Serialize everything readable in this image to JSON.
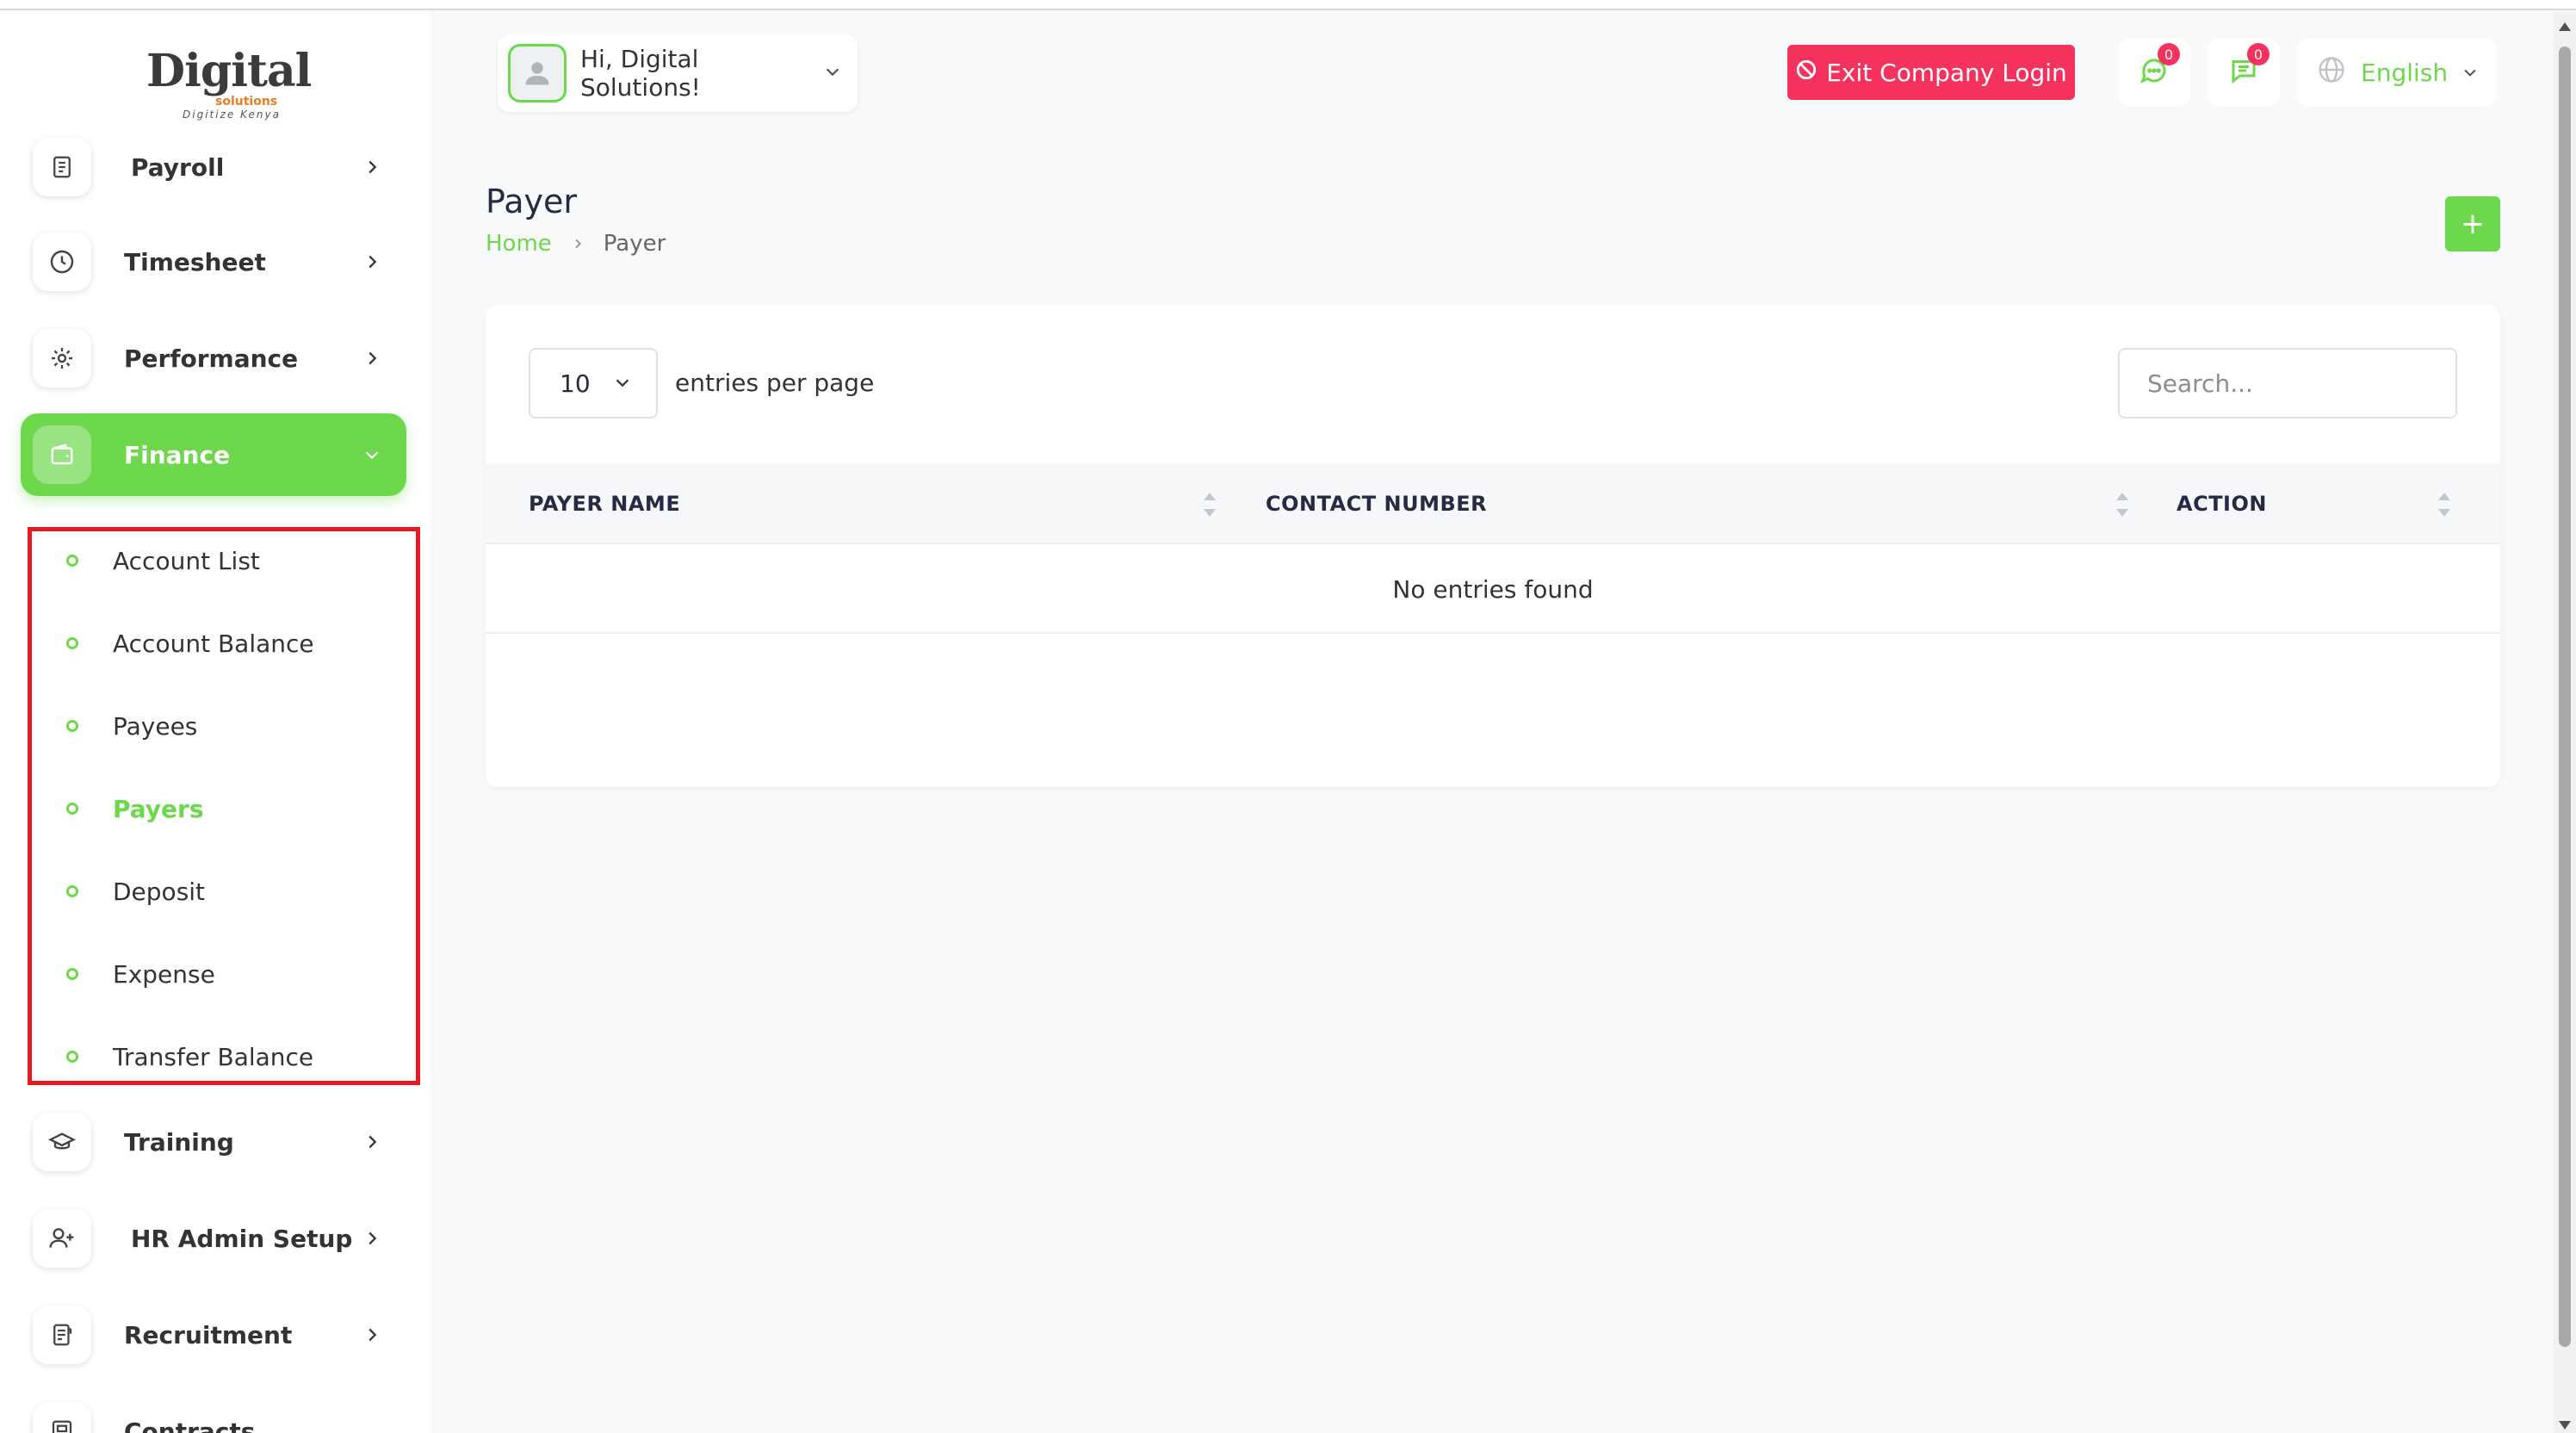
{
  "logo": {
    "main": "Digital",
    "sub": "solutions",
    "tagline": "Digitize Kenya"
  },
  "header": {
    "greeting": "Hi, Digital Solutions!",
    "exit_label": "Exit Company Login",
    "chat_badge": "0",
    "messages_badge": "0",
    "language": "English"
  },
  "sidebar": {
    "items": [
      {
        "label": "Payroll",
        "icon": "receipt-icon"
      },
      {
        "label": "Timesheet",
        "icon": "clock-icon"
      },
      {
        "label": "Performance",
        "icon": "performance-icon"
      },
      {
        "label": "Finance",
        "icon": "wallet-icon"
      },
      {
        "label": "Training",
        "icon": "graduation-cap-icon"
      },
      {
        "label": "HR Admin Setup",
        "icon": "user-plus-icon"
      },
      {
        "label": "Recruitment",
        "icon": "document-icon"
      },
      {
        "label": "Contracts",
        "icon": "contract-icon"
      }
    ],
    "finance_submenu": [
      "Account List",
      "Account Balance",
      "Payees",
      "Payers",
      "Deposit",
      "Expense",
      "Transfer Balance"
    ]
  },
  "page": {
    "title": "Payer",
    "breadcrumb_home": "Home",
    "breadcrumb_current": "Payer",
    "add_button": "+"
  },
  "table": {
    "per_page_value": "10",
    "per_page_label": "entries per page",
    "search_placeholder": "Search...",
    "columns": [
      "PAYER NAME",
      "CONTACT NUMBER",
      "ACTION"
    ],
    "empty_message": "No entries found"
  },
  "colors": {
    "accent": "#6dd84c",
    "danger": "#f5325e",
    "highlight_box": "#e31b23"
  }
}
